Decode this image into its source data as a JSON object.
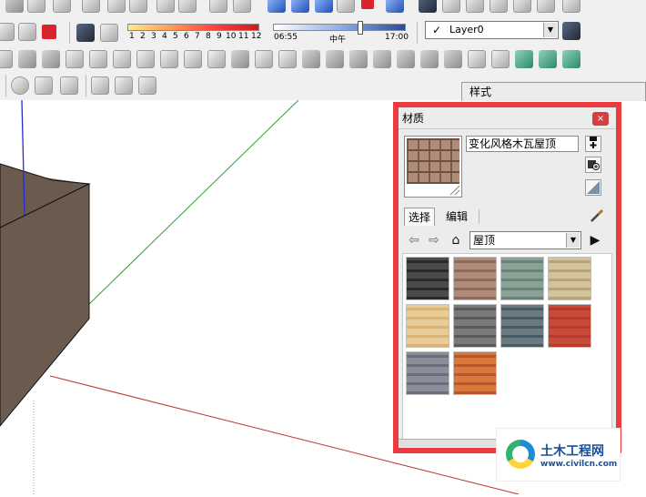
{
  "shadow_settings": {
    "month_ticks": [
      "1",
      "2",
      "3",
      "4",
      "5",
      "6",
      "7",
      "8",
      "9",
      "10",
      "11",
      "12"
    ],
    "time_start": "06:55",
    "time_mid": "中午",
    "time_end": "17:00",
    "time_position": 0.65
  },
  "layers": {
    "current_layer": "Layer0",
    "checkmark": "✓"
  },
  "style_panel": {
    "title": "样式"
  },
  "materials_panel": {
    "title": "材质",
    "close_glyph": "×",
    "material_name": "变化风格木瓦屋顶",
    "tabs": [
      {
        "label": "选择"
      },
      {
        "label": "编辑"
      }
    ],
    "category": "屋顶",
    "dropdown_glyph": "▼",
    "swatches": [
      {
        "color_a": "#2a2a2a",
        "color_b": "#4a4a4a"
      },
      {
        "color_a": "#8a6a58",
        "color_b": "#b08c78"
      },
      {
        "color_a": "#6a8278",
        "color_b": "#8aa296"
      },
      {
        "color_a": "#b8a47a",
        "color_b": "#d4c49c"
      },
      {
        "color_a": "#d8b478",
        "color_b": "#e8cc98"
      },
      {
        "color_a": "#5a5a5a",
        "color_b": "#7a7a7a"
      },
      {
        "color_a": "#4a5a62",
        "color_b": "#6a7a82"
      },
      {
        "color_a": "#b83a2a",
        "color_b": "#c84a3a"
      },
      {
        "color_a": "#6a6e7a",
        "color_b": "#8a8e9a"
      },
      {
        "color_a": "#b8582a",
        "color_b": "#d8783a"
      }
    ]
  },
  "watermark": {
    "brand": "土木工程网",
    "url": "www.civilcn.com"
  },
  "colors": {
    "highlight": "#ea3b3f",
    "red_axis": "#c03030",
    "green_axis": "#2fa02f",
    "blue_axis": "#2a2ad0",
    "box_front": "#6b5a4e",
    "box_top": "#7d6b5e"
  }
}
